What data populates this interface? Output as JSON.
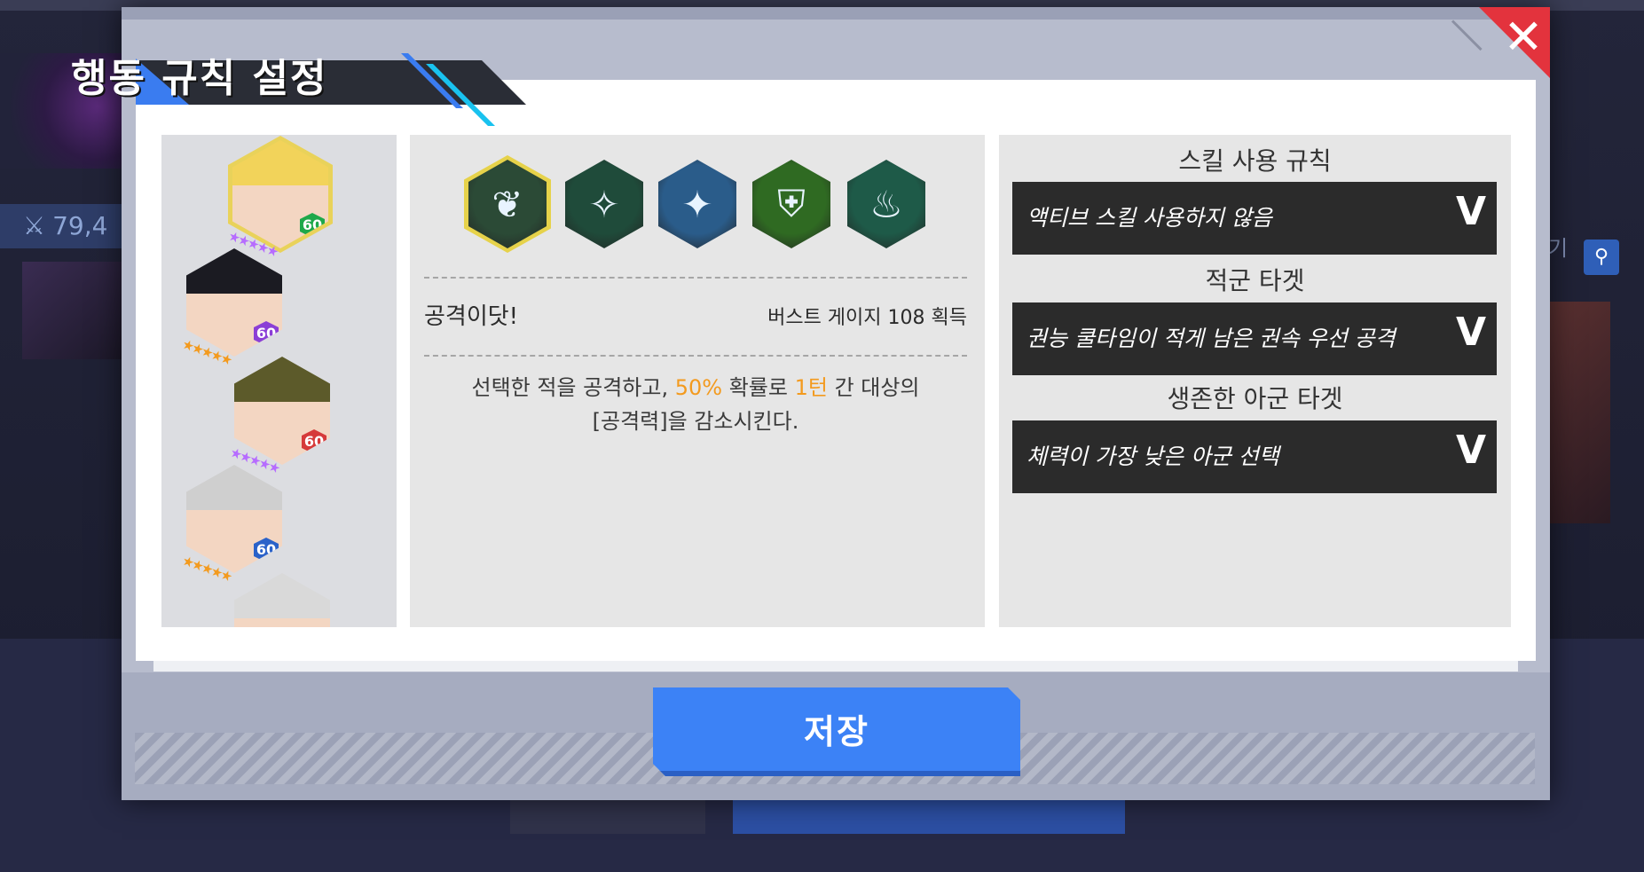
{
  "background": {
    "combat_power": "79,4",
    "side_text": "기",
    "search_icon": "search-icon"
  },
  "modal": {
    "title": "행동 규칙 설정",
    "close_icon": "close-icon"
  },
  "characters": [
    {
      "level": "60",
      "level_color": "#1ea84a",
      "stars": "★★★★★",
      "star_color": "#b66cff",
      "portrait": "blonde-hero",
      "hair": "#f2d35a"
    },
    {
      "level": "60",
      "level_color": "#8b3fd6",
      "stars": "★★★★★",
      "star_color": "#f39a1e",
      "portrait": "dark-hair-hero",
      "hair": "#1b1b22"
    },
    {
      "level": "60",
      "level_color": "#d63a3a",
      "stars": "★★★★★",
      "star_color": "#b66cff",
      "portrait": "green-hair-hero",
      "hair": "#5c5a2a"
    },
    {
      "level": "60",
      "level_color": "#2a62c9",
      "stars": "★★★★★",
      "star_color": "#f39a1e",
      "portrait": "silver-hair-hero",
      "hair": "#cfcfcf"
    },
    {
      "level": "",
      "level_color": "#888888",
      "stars": "",
      "star_color": "#f39a1e",
      "portrait": "elder-hero",
      "hair": "#d9d9d9"
    }
  ],
  "skills": [
    {
      "icon": "heart-swirl-icon",
      "glyph": "❦",
      "bg": "#2b4a36",
      "border": "#e6d24a",
      "selected": true
    },
    {
      "icon": "blue-spiral-icon",
      "glyph": "✧",
      "bg": "#1f4b3a",
      "border": "#3a3a3a",
      "selected": false
    },
    {
      "icon": "crystal-icon",
      "glyph": "✦",
      "bg": "#2a5c8a",
      "border": "#3a3a3a",
      "selected": false
    },
    {
      "icon": "shield-icon",
      "glyph": "⛨",
      "bg": "#2f6a22",
      "border": "#3a3a3a",
      "selected": false
    },
    {
      "icon": "flame-body-icon",
      "glyph": "♨",
      "bg": "#1e5a48",
      "border": "#3a3a3a",
      "selected": false
    }
  ],
  "skill_detail": {
    "name": "공격이닷!",
    "gain": "버스트 게이지 108 획득",
    "desc_1": "선택한 적을 공격하고, ",
    "desc_2": "50%",
    "desc_3": " 확률로 ",
    "desc_4": "1턴",
    "desc_5": " 간 대상의",
    "desc_6": "[공격력]을 감소시킨다."
  },
  "rules": {
    "skill_use_label": "스킬 사용 규칙",
    "skill_use_value": "액티브 스킬 사용하지 않음",
    "enemy_target_label": "적군 타겟",
    "enemy_target_value": "권능 쿨타임이 적게 남은 권속 우선 공격",
    "ally_target_label": "생존한 아군 타겟",
    "ally_target_value": "체력이 가장 낮은 아군 선택",
    "chevron": "V"
  },
  "save_label": "저장"
}
